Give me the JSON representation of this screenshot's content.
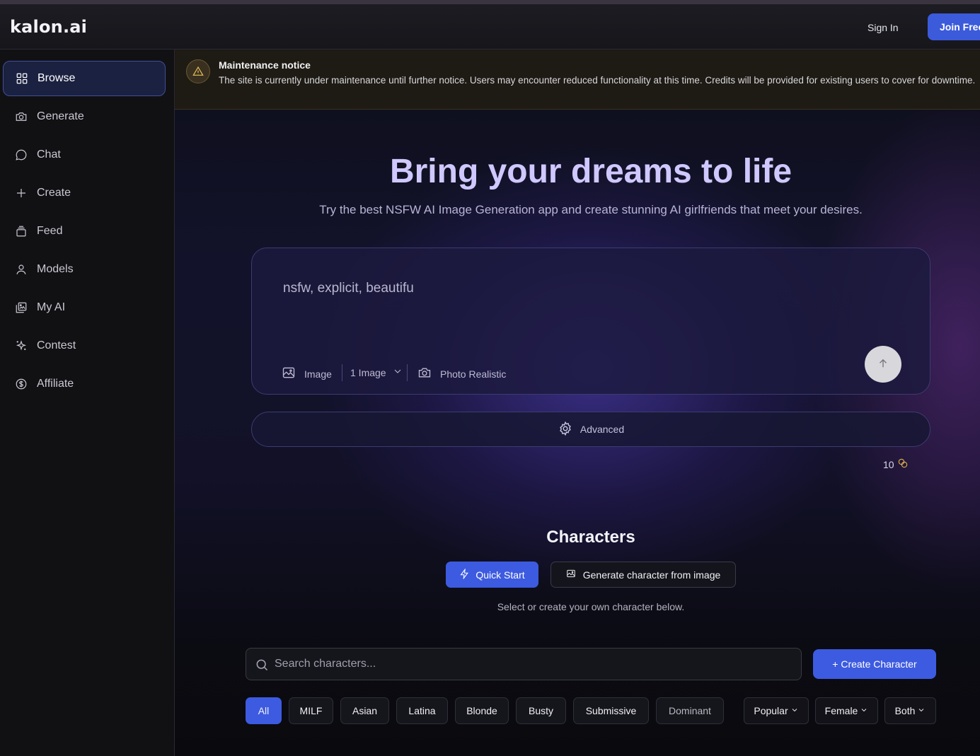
{
  "header": {
    "logo": "kalon.ai",
    "sign_in": "Sign In",
    "join": "Join Free"
  },
  "sidebar": {
    "items": [
      {
        "label": "Browse",
        "icon": "grid-icon",
        "active": true
      },
      {
        "label": "Generate",
        "icon": "camera-icon"
      },
      {
        "label": "Chat",
        "icon": "chat-bubble-icon"
      },
      {
        "label": "Create",
        "icon": "plus-icon"
      },
      {
        "label": "Feed",
        "icon": "stack-icon"
      },
      {
        "label": "Models",
        "icon": "user-icon"
      },
      {
        "label": "My AI",
        "icon": "gallery-icon"
      },
      {
        "label": "Contest",
        "icon": "sparkle-icon"
      },
      {
        "label": "Affiliate",
        "icon": "dollar-circle-icon"
      }
    ]
  },
  "notice": {
    "title": "Maintenance notice",
    "body": "The site is currently under maintenance until further notice. Users may encounter reduced functionality at this time. Credits will be provided for existing users to cover for downtime."
  },
  "hero": {
    "title": "Bring your dreams to life",
    "subtitle": "Try the best NSFW AI Image Generation app and create stunning AI girlfriends that meet your desires."
  },
  "prompt": {
    "text": "nsfw, explicit, beautifu",
    "mode": "Image",
    "count": "1 Image",
    "style": "Photo Realistic"
  },
  "advanced": "Advanced",
  "credits": "10",
  "characters": {
    "title": "Characters",
    "quick_start": "Quick Start",
    "generate_from_image": "Generate character from image",
    "hint": "Select or create your own character below.",
    "search_placeholder": "Search characters...",
    "create_button": "+ Create Character",
    "chips": [
      "All",
      "MILF",
      "Asian",
      "Latina",
      "Blonde",
      "Busty",
      "Submissive",
      "Dominant"
    ],
    "sort": "Popular",
    "gender": "Female",
    "style": "Both"
  },
  "colors": {
    "accent": "#3d5be0",
    "hero_title": "#cfc8ff",
    "warning": "#e6c15a"
  }
}
